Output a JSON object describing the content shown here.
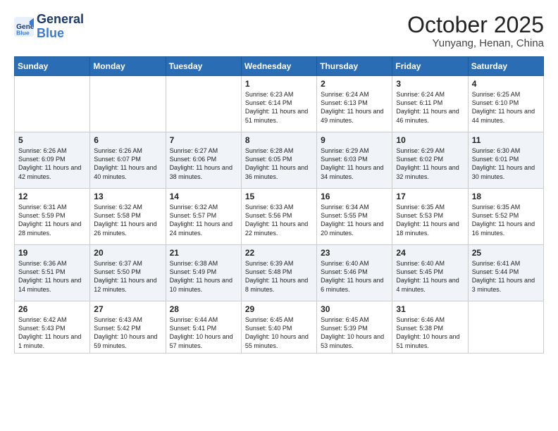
{
  "logo": {
    "line1": "General",
    "line2": "Blue"
  },
  "title": "October 2025",
  "location": "Yunyang, Henan, China",
  "weekdays": [
    "Sunday",
    "Monday",
    "Tuesday",
    "Wednesday",
    "Thursday",
    "Friday",
    "Saturday"
  ],
  "weeks": [
    [
      {
        "day": "",
        "empty": true
      },
      {
        "day": "",
        "empty": true
      },
      {
        "day": "",
        "empty": true
      },
      {
        "day": "1",
        "sunrise": "6:23 AM",
        "sunset": "6:14 PM",
        "daylight": "11 hours and 51 minutes."
      },
      {
        "day": "2",
        "sunrise": "6:24 AM",
        "sunset": "6:13 PM",
        "daylight": "11 hours and 49 minutes."
      },
      {
        "day": "3",
        "sunrise": "6:24 AM",
        "sunset": "6:11 PM",
        "daylight": "11 hours and 46 minutes."
      },
      {
        "day": "4",
        "sunrise": "6:25 AM",
        "sunset": "6:10 PM",
        "daylight": "11 hours and 44 minutes."
      }
    ],
    [
      {
        "day": "5",
        "sunrise": "6:26 AM",
        "sunset": "6:09 PM",
        "daylight": "11 hours and 42 minutes."
      },
      {
        "day": "6",
        "sunrise": "6:26 AM",
        "sunset": "6:07 PM",
        "daylight": "11 hours and 40 minutes."
      },
      {
        "day": "7",
        "sunrise": "6:27 AM",
        "sunset": "6:06 PM",
        "daylight": "11 hours and 38 minutes."
      },
      {
        "day": "8",
        "sunrise": "6:28 AM",
        "sunset": "6:05 PM",
        "daylight": "11 hours and 36 minutes."
      },
      {
        "day": "9",
        "sunrise": "6:29 AM",
        "sunset": "6:03 PM",
        "daylight": "11 hours and 34 minutes."
      },
      {
        "day": "10",
        "sunrise": "6:29 AM",
        "sunset": "6:02 PM",
        "daylight": "11 hours and 32 minutes."
      },
      {
        "day": "11",
        "sunrise": "6:30 AM",
        "sunset": "6:01 PM",
        "daylight": "11 hours and 30 minutes."
      }
    ],
    [
      {
        "day": "12",
        "sunrise": "6:31 AM",
        "sunset": "5:59 PM",
        "daylight": "11 hours and 28 minutes."
      },
      {
        "day": "13",
        "sunrise": "6:32 AM",
        "sunset": "5:58 PM",
        "daylight": "11 hours and 26 minutes."
      },
      {
        "day": "14",
        "sunrise": "6:32 AM",
        "sunset": "5:57 PM",
        "daylight": "11 hours and 24 minutes."
      },
      {
        "day": "15",
        "sunrise": "6:33 AM",
        "sunset": "5:56 PM",
        "daylight": "11 hours and 22 minutes."
      },
      {
        "day": "16",
        "sunrise": "6:34 AM",
        "sunset": "5:55 PM",
        "daylight": "11 hours and 20 minutes."
      },
      {
        "day": "17",
        "sunrise": "6:35 AM",
        "sunset": "5:53 PM",
        "daylight": "11 hours and 18 minutes."
      },
      {
        "day": "18",
        "sunrise": "6:35 AM",
        "sunset": "5:52 PM",
        "daylight": "11 hours and 16 minutes."
      }
    ],
    [
      {
        "day": "19",
        "sunrise": "6:36 AM",
        "sunset": "5:51 PM",
        "daylight": "11 hours and 14 minutes."
      },
      {
        "day": "20",
        "sunrise": "6:37 AM",
        "sunset": "5:50 PM",
        "daylight": "11 hours and 12 minutes."
      },
      {
        "day": "21",
        "sunrise": "6:38 AM",
        "sunset": "5:49 PM",
        "daylight": "11 hours and 10 minutes."
      },
      {
        "day": "22",
        "sunrise": "6:39 AM",
        "sunset": "5:48 PM",
        "daylight": "11 hours and 8 minutes."
      },
      {
        "day": "23",
        "sunrise": "6:40 AM",
        "sunset": "5:46 PM",
        "daylight": "11 hours and 6 minutes."
      },
      {
        "day": "24",
        "sunrise": "6:40 AM",
        "sunset": "5:45 PM",
        "daylight": "11 hours and 4 minutes."
      },
      {
        "day": "25",
        "sunrise": "6:41 AM",
        "sunset": "5:44 PM",
        "daylight": "11 hours and 3 minutes."
      }
    ],
    [
      {
        "day": "26",
        "sunrise": "6:42 AM",
        "sunset": "5:43 PM",
        "daylight": "11 hours and 1 minute."
      },
      {
        "day": "27",
        "sunrise": "6:43 AM",
        "sunset": "5:42 PM",
        "daylight": "10 hours and 59 minutes."
      },
      {
        "day": "28",
        "sunrise": "6:44 AM",
        "sunset": "5:41 PM",
        "daylight": "10 hours and 57 minutes."
      },
      {
        "day": "29",
        "sunrise": "6:45 AM",
        "sunset": "5:40 PM",
        "daylight": "10 hours and 55 minutes."
      },
      {
        "day": "30",
        "sunrise": "6:45 AM",
        "sunset": "5:39 PM",
        "daylight": "10 hours and 53 minutes."
      },
      {
        "day": "31",
        "sunrise": "6:46 AM",
        "sunset": "5:38 PM",
        "daylight": "10 hours and 51 minutes."
      },
      {
        "day": "",
        "empty": true
      }
    ]
  ]
}
